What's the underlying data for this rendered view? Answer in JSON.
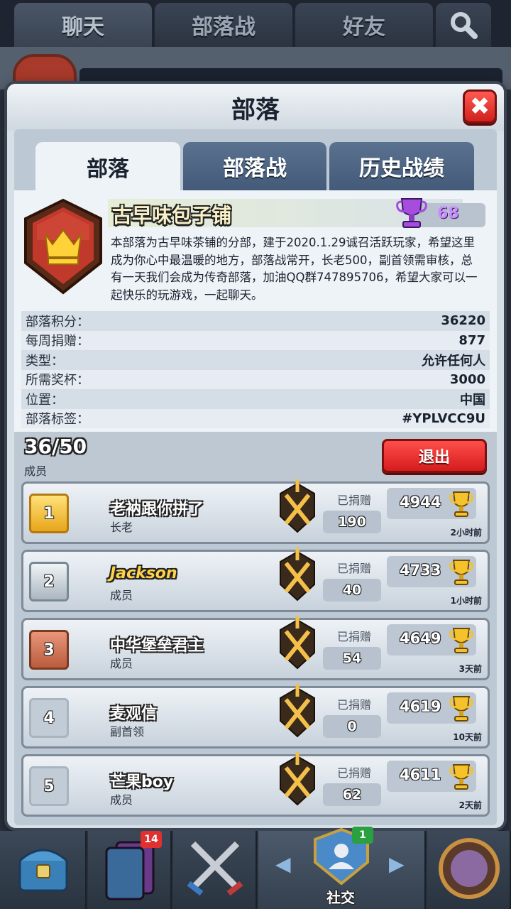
{
  "top_tabs": [
    "聊天",
    "部落战",
    "好友"
  ],
  "modal": {
    "title": "部落",
    "close_label": "✖",
    "tabs": [
      "部落",
      "部落战",
      "历史战绩"
    ]
  },
  "clan": {
    "name": "古早味包子铺",
    "score": "68",
    "description": "本部落为古早味茶铺的分部，建于2020.1.29诚召活跃玩家，希望这里成为你心中最温暖的地方，部落战常开，长老500，副首领需审核，总有一天我们会成为传奇部落，加油QQ群747895706，希望大家可以一起快乐的玩游戏，一起聊天。",
    "stats": [
      {
        "label": "部落积分：",
        "value": "36220"
      },
      {
        "label": "每周捐赠：",
        "value": "877"
      },
      {
        "label": "类型：",
        "value": "允许任何人"
      },
      {
        "label": "所需奖杯：",
        "value": "3000"
      },
      {
        "label": "位置：",
        "value": "中国"
      },
      {
        "label": "部落标签：",
        "value": "#YPLVCC9U"
      }
    ]
  },
  "members_section": {
    "count": "36/50",
    "label": "成员",
    "leave_label": "退出"
  },
  "members": [
    {
      "rank": "1",
      "name": "老衲跟你拼了",
      "role": "长老",
      "donated_label": "已捐赠",
      "donated": "190",
      "trophies": "4944",
      "last_seen": "2小时前"
    },
    {
      "rank": "2",
      "name": "Jackson",
      "role": "成员",
      "donated_label": "已捐赠",
      "donated": "40",
      "trophies": "4733",
      "last_seen": "1小时前"
    },
    {
      "rank": "3",
      "name": "中华堡垒君主",
      "role": "成员",
      "donated_label": "已捐赠",
      "donated": "54",
      "trophies": "4649",
      "last_seen": "3天前"
    },
    {
      "rank": "4",
      "name": "麦观信",
      "role": "副首领",
      "donated_label": "已捐赠",
      "donated": "0",
      "trophies": "4619",
      "last_seen": "10天前"
    },
    {
      "rank": "5",
      "name": "芒果boy",
      "role": "成员",
      "donated_label": "已捐赠",
      "donated": "62",
      "trophies": "4611",
      "last_seen": "2天前"
    }
  ],
  "bottom_nav": {
    "social_label": "社交",
    "cards_badge": "14",
    "social_badge": "1"
  },
  "colors": {
    "close_red": "#e0302a",
    "gold_rank": "#f2c23a",
    "trophy_purple": "#c98cff"
  }
}
